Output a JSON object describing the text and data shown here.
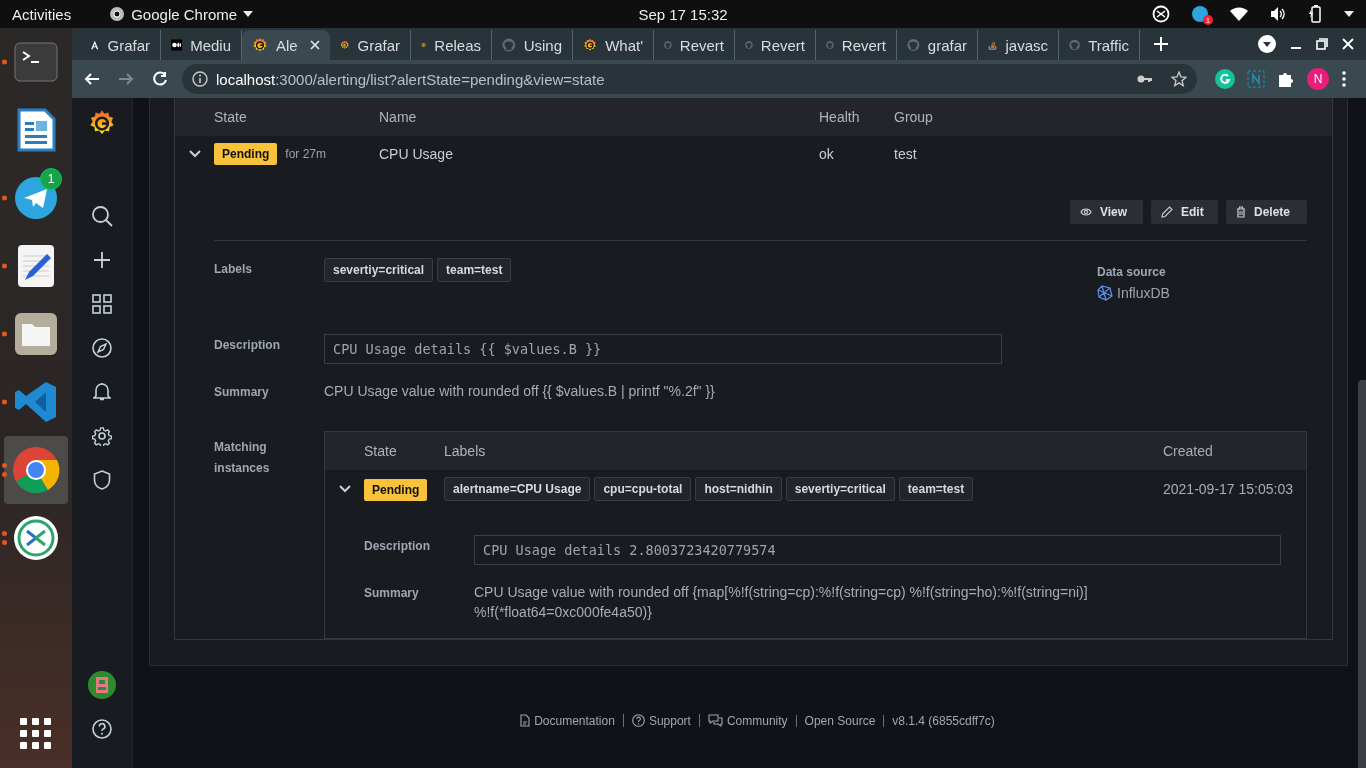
{
  "top_bar": {
    "activities": "Activities",
    "app_menu": "Google Chrome",
    "clock": "Sep 17  15:32",
    "tray_badge": "1"
  },
  "dock": [
    {
      "kind": "terminal",
      "running": true,
      "multiple": false,
      "selected": false
    },
    {
      "kind": "document",
      "running": false,
      "selected": false
    },
    {
      "kind": "telegram",
      "running": true,
      "multiple": false,
      "selected": false,
      "badge": "1"
    },
    {
      "kind": "text-editor",
      "running": true,
      "multiple": false,
      "selected": false
    },
    {
      "kind": "files",
      "running": true,
      "multiple": false,
      "selected": false
    },
    {
      "kind": "vscode",
      "running": true,
      "multiple": false,
      "selected": false
    },
    {
      "kind": "chrome",
      "running": true,
      "multiple": true,
      "selected": true
    },
    {
      "kind": "remote-desktop",
      "running": true,
      "multiple": true,
      "selected": false
    }
  ],
  "browser": {
    "tabs": [
      {
        "kind": "angular",
        "title": "Grafar",
        "selected": false
      },
      {
        "kind": "medium",
        "title": "Mediu",
        "selected": false
      },
      {
        "kind": "grafana",
        "title": "Ale",
        "selected": true
      },
      {
        "kind": "grafana",
        "title": "Grafar",
        "selected": false
      },
      {
        "kind": "grafana",
        "title": "Releas",
        "selected": false
      },
      {
        "kind": "github",
        "title": "Using",
        "selected": false
      },
      {
        "kind": "grafana",
        "title": "What'",
        "selected": false
      },
      {
        "kind": "github",
        "title": "Revert",
        "selected": false
      },
      {
        "kind": "github",
        "title": "Revert",
        "selected": false
      },
      {
        "kind": "github",
        "title": "Revert",
        "selected": false
      },
      {
        "kind": "github",
        "title": "grafar",
        "selected": false
      },
      {
        "kind": "stackoverflow",
        "title": "javasc",
        "selected": false
      },
      {
        "kind": "github",
        "title": "Traffic",
        "selected": false
      }
    ],
    "nav_buttons": [
      {
        "kind": "back",
        "disabled": false
      },
      {
        "kind": "forward",
        "disabled": true
      },
      {
        "kind": "reload",
        "disabled": false
      }
    ],
    "url_host": "localhost",
    "url_rest": ":3000/alerting/list?alertState=pending&view=state",
    "profile": "N"
  },
  "grafana_nav": {
    "items": [
      {
        "kind": "search"
      },
      {
        "kind": "plus"
      },
      {
        "kind": "dashboards"
      },
      {
        "kind": "explore"
      },
      {
        "kind": "alerting"
      },
      {
        "kind": "configuration"
      },
      {
        "kind": "shield"
      }
    ]
  },
  "rules_table": {
    "columns": [
      "State",
      "Name",
      "Health",
      "Group"
    ],
    "rule": {
      "state": "Pending",
      "color": "#f8c23c",
      "duration": "for 27m",
      "name": "CPU Usage",
      "health": "ok",
      "group": "test",
      "expanded": true,
      "actions": [
        {
          "kind": "view",
          "label": "View"
        },
        {
          "kind": "edit",
          "label": "Edit"
        },
        {
          "kind": "delete",
          "label": "Delete"
        }
      ],
      "labels_title": "Labels",
      "labels": [
        "severtiy=critical",
        "team=test"
      ],
      "data_source_title": "Data source",
      "data_source": "InfluxDB",
      "description_title": "Description",
      "description": "CPU Usage details {{ $values.B }}",
      "summary_title": "Summary",
      "summary": "CPU Usage value with rounded off {{ $values.B | printf \"%.2f\" }}",
      "instances_title": "Matching instances",
      "instances": {
        "columns": [
          "State",
          "Labels",
          "Created"
        ],
        "rows": [
          {
            "state": "Pending",
            "color": "#f8c23c",
            "labels": [
              "alertname=CPU Usage",
              "cpu=cpu-total",
              "host=nidhin",
              "severtiy=critical",
              "team=test"
            ],
            "created": "2021-09-17 15:05:03",
            "expanded": true,
            "description_title": "Description",
            "description": "CPU Usage details 2.8003723420779574",
            "summary_title": "Summary",
            "summary": "CPU Usage value with rounded off {map[%!f(string=cp):%!f(string=cp) %!f(string=ho):%!f(string=ni)] %!f(*float64=0xc000fe4a50)}"
          }
        ]
      }
    }
  },
  "footer": {
    "links": [
      {
        "kind": "document",
        "label": "Documentation"
      },
      {
        "kind": "question",
        "label": "Support"
      },
      {
        "kind": "chat",
        "label": "Community"
      },
      {
        "kind": "none",
        "label": "Open Source"
      },
      {
        "kind": "none",
        "label": "v8.1.4 (6855cdff7c)"
      }
    ]
  }
}
